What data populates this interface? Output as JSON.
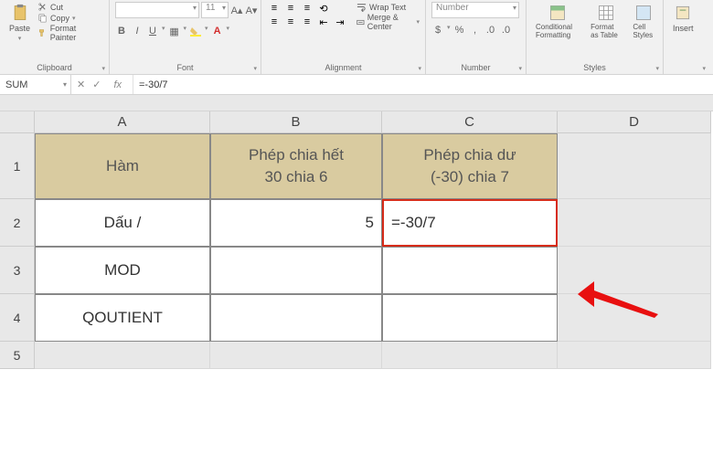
{
  "ribbon": {
    "clipboard": {
      "label": "Clipboard",
      "paste": "Paste",
      "cut": "Cut",
      "copy": "Copy",
      "painter": "Format Painter"
    },
    "font": {
      "label": "Font",
      "size": "11"
    },
    "alignment": {
      "label": "Alignment",
      "wrap": "Wrap Text",
      "merge": "Merge & Center"
    },
    "number": {
      "label": "Number",
      "format": "Number"
    },
    "styles": {
      "label": "Styles",
      "cond": "Conditional Formatting",
      "table": "Format as Table",
      "cell": "Cell Styles"
    },
    "cells": {
      "insert": "Insert"
    }
  },
  "formula_bar": {
    "name_box": "SUM",
    "formula": "=-30/7"
  },
  "columns": [
    "A",
    "B",
    "C",
    "D"
  ],
  "rows": [
    "1",
    "2",
    "3",
    "4",
    "5"
  ],
  "table": {
    "headers": {
      "A": "Hàm",
      "B_line1": "Phép chia hết",
      "B_line2": "30 chia 6",
      "C_line1": "Phép chia dư",
      "C_line2": "(-30) chia 7"
    },
    "rows": [
      {
        "A": "Dấu /",
        "B": "5",
        "C": "=-30/7"
      },
      {
        "A": "MOD",
        "B": "",
        "C": ""
      },
      {
        "A": "QOUTIENT",
        "B": "",
        "C": ""
      }
    ]
  }
}
